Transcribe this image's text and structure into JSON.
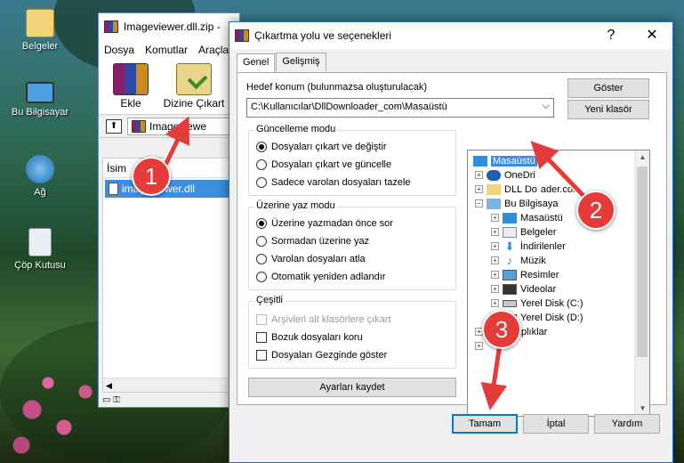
{
  "desktop": {
    "icons": [
      {
        "label": "Belgeler",
        "icon": "documents-folder-icon"
      },
      {
        "label": "Bu Bilgisayar",
        "icon": "computer-icon"
      },
      {
        "label": "Ağ",
        "icon": "network-icon"
      },
      {
        "label": "Çöp Kutusu",
        "icon": "recycle-bin-icon"
      }
    ]
  },
  "main_window": {
    "title": "Imageviewer.dll.zip -",
    "menu": [
      "Dosya",
      "Komutlar",
      "Araçla"
    ],
    "tools": [
      "Ekle",
      "Dizine Çıkart"
    ],
    "path": "Imageviewe",
    "column": "İsim",
    "file": "imageviewer.dll"
  },
  "dialog": {
    "title": "Çıkartma yolu ve seçenekleri",
    "help": "?",
    "close": "✕",
    "tabs": [
      "Genel",
      "Gelişmiş"
    ],
    "dest_label": "Hedef konum (bulunmazsa oluşturulacak)",
    "dest_value": "C:\\Kullanıcılar\\DllDownloader_com\\Masaüstü",
    "btn_show": "Göster",
    "btn_newfolder": "Yeni klasör",
    "update_mode": {
      "title": "Güncelleme modu",
      "options": [
        "Dosyaları çıkart ve değiştir",
        "Dosyaları çıkart ve güncelle",
        "Sadece varolan dosyaları tazele"
      ],
      "selected": 0
    },
    "overwrite_mode": {
      "title": "Üzerine yaz modu",
      "options": [
        "Üzerine yazmadan önce sor",
        "Sormadan üzerine yaz",
        "Varolan dosyaları atla",
        "Otomatik yeniden adlandır"
      ],
      "selected": 0
    },
    "misc": {
      "title": "Çeşitli",
      "options": [
        "Arşivleri alt klasörlere çıkart",
        "Bozuk dosyaları koru",
        "Dosyaları Gezginde göster"
      ]
    },
    "btn_save": "Ayarları kaydet",
    "tree": [
      {
        "label": "Masaüstü",
        "selected": true
      },
      {
        "label": "OneDri"
      },
      {
        "label": "DLL Do",
        "tail": "ader.com"
      },
      {
        "label": "Bu Bilgisaya"
      },
      {
        "label": "Masaüstü"
      },
      {
        "label": "Belgeler"
      },
      {
        "label": "İndirilenler"
      },
      {
        "label": "Müzik"
      },
      {
        "label": "Resimler"
      },
      {
        "label": "Videolar"
      },
      {
        "label": "Yerel Disk (C:)"
      },
      {
        "label": "Yerel Disk (D:)"
      },
      {
        "label": "Kitaplıklar"
      }
    ],
    "btn_ok": "Tamam",
    "btn_cancel": "İptal",
    "btn_help": "Yardım"
  },
  "annotations": [
    "1",
    "2",
    "3"
  ],
  "colors": {
    "accent": "#3b8ee0",
    "badge": "#e53b3b"
  }
}
